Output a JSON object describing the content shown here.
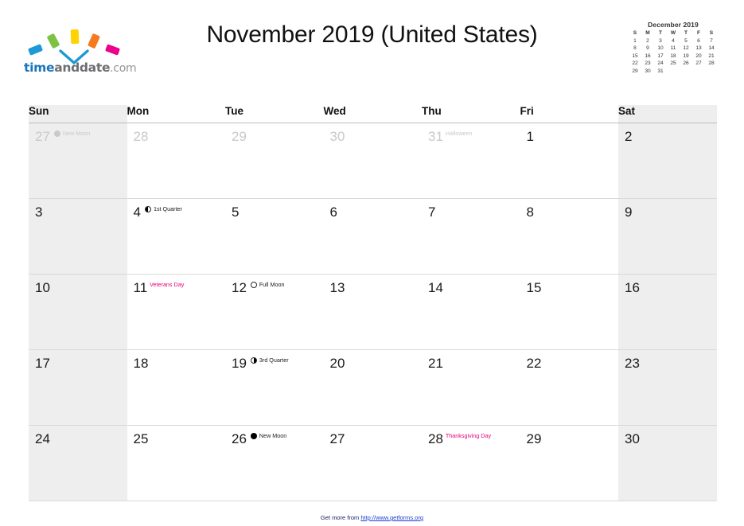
{
  "brand": {
    "name_part1": "time",
    "name_part2": "anddate",
    "name_part3": ".com",
    "logo_icon": "timeanddate-logo",
    "colors": {
      "blue": "#1b9ad6",
      "green": "#7dc242",
      "yellow": "#ffd200",
      "orange": "#f47b20",
      "pink": "#ec008c",
      "wordmark_blue": "#1b75bb",
      "wordmark_gray": "#6d6e71"
    }
  },
  "header": {
    "title": "November 2019 (United States)"
  },
  "mini_calendar": {
    "title": "December 2019",
    "dow": [
      "S",
      "M",
      "T",
      "W",
      "T",
      "F",
      "S"
    ],
    "leading_blanks": 0,
    "days": [
      1,
      2,
      3,
      4,
      5,
      6,
      7,
      8,
      9,
      10,
      11,
      12,
      13,
      14,
      15,
      16,
      17,
      18,
      19,
      20,
      21,
      22,
      23,
      24,
      25,
      26,
      27,
      28,
      29,
      30,
      31
    ]
  },
  "calendar": {
    "month": "November",
    "year": "2019",
    "region": "United States",
    "dow_headers": [
      "Sun",
      "Mon",
      "Tue",
      "Wed",
      "Thu",
      "Fri",
      "Sat"
    ],
    "weekend_columns": [
      0,
      6
    ],
    "weeks": [
      [
        {
          "day": "27",
          "other_month": true,
          "moon": "new",
          "events": [
            {
              "text": "New Moon",
              "type": "moon"
            }
          ]
        },
        {
          "day": "28",
          "other_month": true,
          "moon": null,
          "events": []
        },
        {
          "day": "29",
          "other_month": true,
          "moon": null,
          "events": []
        },
        {
          "day": "30",
          "other_month": true,
          "moon": null,
          "events": []
        },
        {
          "day": "31",
          "other_month": true,
          "moon": null,
          "events": [
            {
              "text": "Halloween",
              "type": "note"
            }
          ]
        },
        {
          "day": "1",
          "other_month": false,
          "moon": null,
          "events": []
        },
        {
          "day": "2",
          "other_month": false,
          "moon": null,
          "events": []
        }
      ],
      [
        {
          "day": "3",
          "other_month": false,
          "moon": null,
          "events": []
        },
        {
          "day": "4",
          "other_month": false,
          "moon": "first",
          "events": [
            {
              "text": "1st Quarter",
              "type": "moon"
            }
          ]
        },
        {
          "day": "5",
          "other_month": false,
          "moon": null,
          "events": []
        },
        {
          "day": "6",
          "other_month": false,
          "moon": null,
          "events": []
        },
        {
          "day": "7",
          "other_month": false,
          "moon": null,
          "events": []
        },
        {
          "day": "8",
          "other_month": false,
          "moon": null,
          "events": []
        },
        {
          "day": "9",
          "other_month": false,
          "moon": null,
          "events": []
        }
      ],
      [
        {
          "day": "10",
          "other_month": false,
          "moon": null,
          "events": []
        },
        {
          "day": "11",
          "other_month": false,
          "moon": null,
          "events": [
            {
              "text": "Veterans Day",
              "type": "holiday"
            }
          ]
        },
        {
          "day": "12",
          "other_month": false,
          "moon": "full",
          "events": [
            {
              "text": "Full Moon",
              "type": "moon"
            }
          ]
        },
        {
          "day": "13",
          "other_month": false,
          "moon": null,
          "events": []
        },
        {
          "day": "14",
          "other_month": false,
          "moon": null,
          "events": []
        },
        {
          "day": "15",
          "other_month": false,
          "moon": null,
          "events": []
        },
        {
          "day": "16",
          "other_month": false,
          "moon": null,
          "events": []
        }
      ],
      [
        {
          "day": "17",
          "other_month": false,
          "moon": null,
          "events": []
        },
        {
          "day": "18",
          "other_month": false,
          "moon": null,
          "events": []
        },
        {
          "day": "19",
          "other_month": false,
          "moon": "third",
          "events": [
            {
              "text": "3rd Quarter",
              "type": "moon"
            }
          ]
        },
        {
          "day": "20",
          "other_month": false,
          "moon": null,
          "events": []
        },
        {
          "day": "21",
          "other_month": false,
          "moon": null,
          "events": []
        },
        {
          "day": "22",
          "other_month": false,
          "moon": null,
          "events": []
        },
        {
          "day": "23",
          "other_month": false,
          "moon": null,
          "events": []
        }
      ],
      [
        {
          "day": "24",
          "other_month": false,
          "moon": null,
          "events": []
        },
        {
          "day": "25",
          "other_month": false,
          "moon": null,
          "events": []
        },
        {
          "day": "26",
          "other_month": false,
          "moon": "new",
          "events": [
            {
              "text": "New Moon",
              "type": "moon"
            }
          ]
        },
        {
          "day": "27",
          "other_month": false,
          "moon": null,
          "events": []
        },
        {
          "day": "28",
          "other_month": false,
          "moon": null,
          "events": [
            {
              "text": "Thanksgiving Day",
              "type": "holiday"
            }
          ]
        },
        {
          "day": "29",
          "other_month": false,
          "moon": null,
          "events": []
        },
        {
          "day": "30",
          "other_month": false,
          "moon": null,
          "events": []
        }
      ]
    ]
  },
  "footer": {
    "prefix": "Get more from ",
    "link_text": "http://www.getforms.org"
  },
  "colors": {
    "holiday": "#e6007e",
    "link": "#1b3fd1",
    "weekend_bg": "#eeeeee",
    "othermonth_text": "#c9c9c9"
  }
}
